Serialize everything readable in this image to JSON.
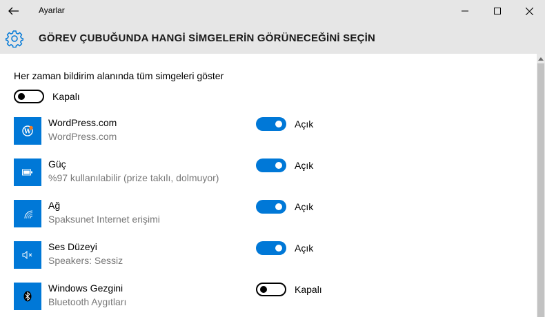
{
  "window": {
    "app_title": "Ayarlar",
    "back_icon": "back-arrow-icon",
    "minimize_icon": "minimize-icon",
    "maximize_icon": "maximize-icon",
    "close_icon": "close-icon"
  },
  "header": {
    "icon": "gear-icon",
    "title": "GÖREV ÇUBUĞUNDA HANGİ SİMGELERİN GÖRÜNECEĞİNİ SEÇİN"
  },
  "always_show": {
    "label": "Her zaman bildirim alanında tüm simgeleri göster",
    "state": "Kapalı",
    "on": false
  },
  "items": [
    {
      "name": "WordPress.com",
      "desc": "WordPress.com",
      "state": "Açık",
      "on": true,
      "icon": "wordpress-icon"
    },
    {
      "name": "Güç",
      "desc": "%97 kullanılabilir (prize takılı, dolmuyor)",
      "state": "Açık",
      "on": true,
      "icon": "battery-icon"
    },
    {
      "name": "Ağ",
      "desc": "Spaksunet Internet erişimi",
      "state": "Açık",
      "on": true,
      "icon": "wifi-icon"
    },
    {
      "name": "Ses Düzeyi",
      "desc": "Speakers: Sessiz",
      "state": "Açık",
      "on": true,
      "icon": "speaker-muted-icon"
    },
    {
      "name": "Windows Gezgini",
      "desc": "Bluetooth Aygıtları",
      "state": "Kapalı",
      "on": false,
      "icon": "bluetooth-icon"
    }
  ],
  "colors": {
    "accent": "#0078d7",
    "chrome": "#e6e6e6",
    "secondary_text": "#777777"
  }
}
